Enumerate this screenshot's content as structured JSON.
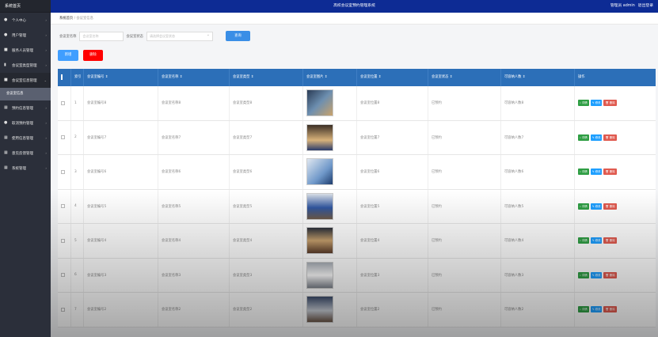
{
  "sidebar": {
    "brand": "系统首页",
    "items": [
      {
        "label": "个人中心",
        "icon": "person-icon"
      },
      {
        "label": "用户管理",
        "icon": "user-icon"
      },
      {
        "label": "服务人员管理",
        "icon": "staff-icon"
      },
      {
        "label": "会议室类型管理",
        "icon": "chart-icon"
      },
      {
        "label": "会议室信息管理",
        "icon": "folder-icon",
        "open": true
      },
      {
        "label": "预约信息管理",
        "icon": "grid-icon"
      },
      {
        "label": "取消预约管理",
        "icon": "person-icon"
      },
      {
        "label": "使用信息管理",
        "icon": "grid-icon"
      },
      {
        "label": "意见反馈管理",
        "icon": "grid-icon"
      },
      {
        "label": "系统管理",
        "icon": "grid-icon"
      }
    ],
    "sub_item": "会议室信息"
  },
  "header": {
    "title": "高校会议室预约管理系统",
    "user": "管理员 admin",
    "logout": "退出登录"
  },
  "breadcrumb": {
    "home": "系统首页",
    "current": "会议室信息"
  },
  "search": {
    "name_label": "会议室名称",
    "name_placeholder": "会议室名称",
    "status_label": "会议室状态",
    "status_placeholder": "请选择会议室状态",
    "button": "查询"
  },
  "actions": {
    "add": "新增",
    "delete": "删除"
  },
  "table": {
    "headers": [
      "索引",
      "会议室编号 ⇕",
      "会议室名称 ⇕",
      "会议室类型 ⇕",
      "会议室图片 ⇕",
      "会议室位置 ⇕",
      "会议室状态 ⇕",
      "可容纳人数 ⇕",
      "操作"
    ],
    "rows": [
      {
        "idx": "1",
        "code": "会议室编号8",
        "name": "会议室名称8",
        "type": "会议室类型8",
        "location": "会议室位置8",
        "status": "已预约",
        "capacity": "可容纳人数8"
      },
      {
        "idx": "2",
        "code": "会议室编号7",
        "name": "会议室名称7",
        "type": "会议室类型7",
        "location": "会议室位置7",
        "status": "已预约",
        "capacity": "可容纳人数7"
      },
      {
        "idx": "3",
        "code": "会议室编号6",
        "name": "会议室名称6",
        "type": "会议室类型6",
        "location": "会议室位置6",
        "status": "已预约",
        "capacity": "可容纳人数6"
      },
      {
        "idx": "4",
        "code": "会议室编号5",
        "name": "会议室名称5",
        "type": "会议室类型5",
        "location": "会议室位置5",
        "status": "已预约",
        "capacity": "可容纳人数5"
      },
      {
        "idx": "5",
        "code": "会议室编号4",
        "name": "会议室名称4",
        "type": "会议室类型4",
        "location": "会议室位置4",
        "status": "已预约",
        "capacity": "可容纳人数4"
      },
      {
        "idx": "6",
        "code": "会议室编号3",
        "name": "会议室名称3",
        "type": "会议室类型3",
        "location": "会议室位置3",
        "status": "已预约",
        "capacity": "可容纳人数3"
      },
      {
        "idx": "7",
        "code": "会议室编号2",
        "name": "会议室名称2",
        "type": "会议室类型2",
        "location": "会议室位置2",
        "status": "已预约",
        "capacity": "可容纳人数2"
      }
    ],
    "ops": {
      "view": "详情",
      "edit": "修改",
      "delete": "删除"
    }
  },
  "colors": {
    "header": "#0d2b94",
    "sidebar": "#2b2f3a",
    "table_head": "#2c6fb8",
    "add": "#409eff",
    "delete": "#ff0000"
  }
}
